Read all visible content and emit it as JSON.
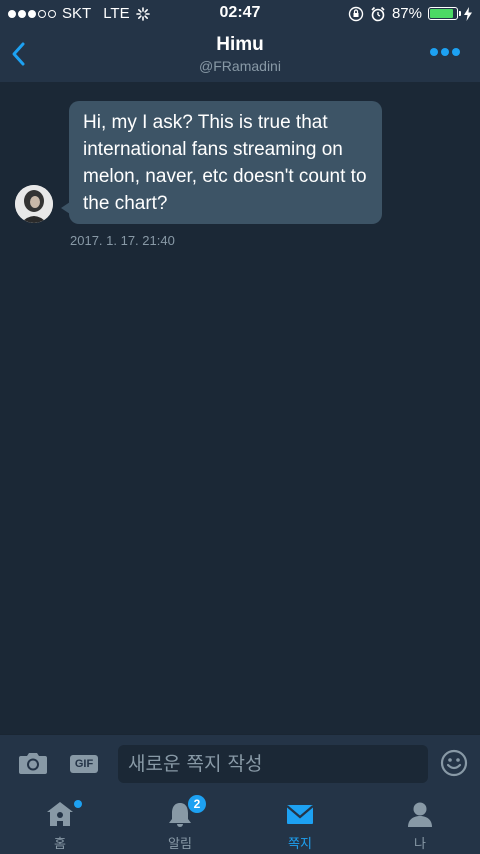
{
  "status_bar": {
    "carrier": "SKT",
    "network": "LTE",
    "time": "02:47",
    "battery_percent": "87%",
    "battery_level": 0.87
  },
  "header": {
    "title": "Himu",
    "subtitle": "@FRamadini"
  },
  "conversation": {
    "messages": [
      {
        "text": "Hi, my I ask? This is true that international fans streaming on melon, naver, etc doesn't count to the chart?",
        "timestamp": "2017. 1. 17. 21:40"
      }
    ]
  },
  "composer": {
    "gif_label": "GIF",
    "placeholder": "새로운 쪽지 작성"
  },
  "tabs": [
    {
      "label": "홈",
      "icon": "home-icon"
    },
    {
      "label": "알림",
      "icon": "bell-icon",
      "badge": "2"
    },
    {
      "label": "쪽지",
      "icon": "envelope-icon"
    },
    {
      "label": "나",
      "icon": "person-icon"
    }
  ],
  "colors": {
    "accent": "#1da1f2",
    "background": "#1b2836",
    "bars": "#243447",
    "bubble": "#3d5466",
    "muted": "#8899a6"
  }
}
